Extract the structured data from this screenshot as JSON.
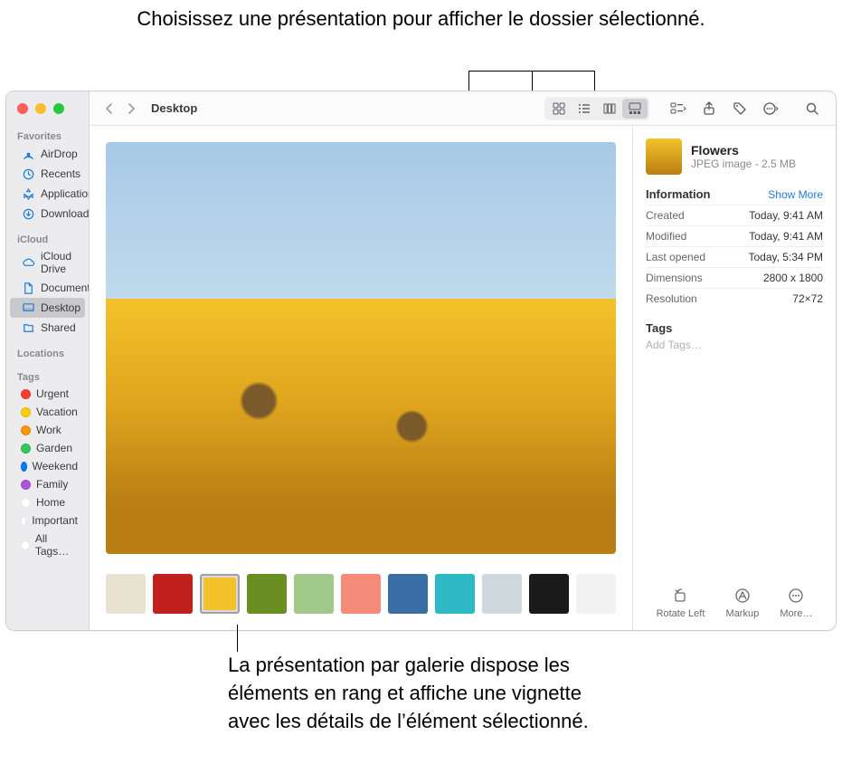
{
  "callouts": {
    "top": "Choisissez une présentation pour afficher le dossier sélectionné.",
    "bottom": "La présentation par galerie dispose les éléments en rang et affiche une vignette avec les détails de l’élément sélectionné."
  },
  "toolbar": {
    "title": "Desktop"
  },
  "sidebar": {
    "favorites_label": "Favorites",
    "favorites": [
      {
        "label": "AirDrop",
        "icon": "airdrop"
      },
      {
        "label": "Recents",
        "icon": "clock"
      },
      {
        "label": "Applications",
        "icon": "apps"
      },
      {
        "label": "Downloads",
        "icon": "download"
      }
    ],
    "icloud_label": "iCloud",
    "icloud": [
      {
        "label": "iCloud Drive",
        "icon": "cloud"
      },
      {
        "label": "Documents",
        "icon": "doc"
      },
      {
        "label": "Desktop",
        "icon": "desktop",
        "selected": true
      },
      {
        "label": "Shared",
        "icon": "shared"
      }
    ],
    "locations_label": "Locations",
    "tags_label": "Tags",
    "tags": [
      {
        "label": "Urgent",
        "color": "#ff3b30"
      },
      {
        "label": "Vacation",
        "color": "#ffcc00"
      },
      {
        "label": "Work",
        "color": "#ff9500"
      },
      {
        "label": "Garden",
        "color": "#34c759"
      },
      {
        "label": "Weekend",
        "color": "#007aff"
      },
      {
        "label": "Family",
        "color": "#af52de"
      },
      {
        "label": "Home",
        "color": "#ffffff"
      },
      {
        "label": "Important",
        "color": "#ffffff"
      },
      {
        "label": "All Tags…",
        "color": "#ffffff"
      }
    ]
  },
  "thumbnails": {
    "count": 11,
    "selected_index": 2
  },
  "inspector": {
    "filename": "Flowers",
    "kind": "JPEG image - 2.5 MB",
    "info_label": "Information",
    "show_more": "Show More",
    "rows": [
      {
        "k": "Created",
        "v": "Today, 9:41 AM"
      },
      {
        "k": "Modified",
        "v": "Today, 9:41 AM"
      },
      {
        "k": "Last opened",
        "v": "Today, 5:34 PM"
      },
      {
        "k": "Dimensions",
        "v": "2800 x 1800"
      },
      {
        "k": "Resolution",
        "v": "72×72"
      }
    ],
    "tags_label": "Tags",
    "tags_placeholder": "Add Tags…",
    "actions": {
      "rotate": "Rotate Left",
      "markup": "Markup",
      "more": "More…"
    }
  },
  "thumb_colors": [
    "#e8e3d0",
    "#c21f1f",
    "#f3c22a",
    "#6b8e23",
    "#a0c88a",
    "#f58b7a",
    "#3a6ea5",
    "#2fb9c4",
    "#cfd8dc",
    "#1a1a1a",
    "#f2f2f2"
  ]
}
